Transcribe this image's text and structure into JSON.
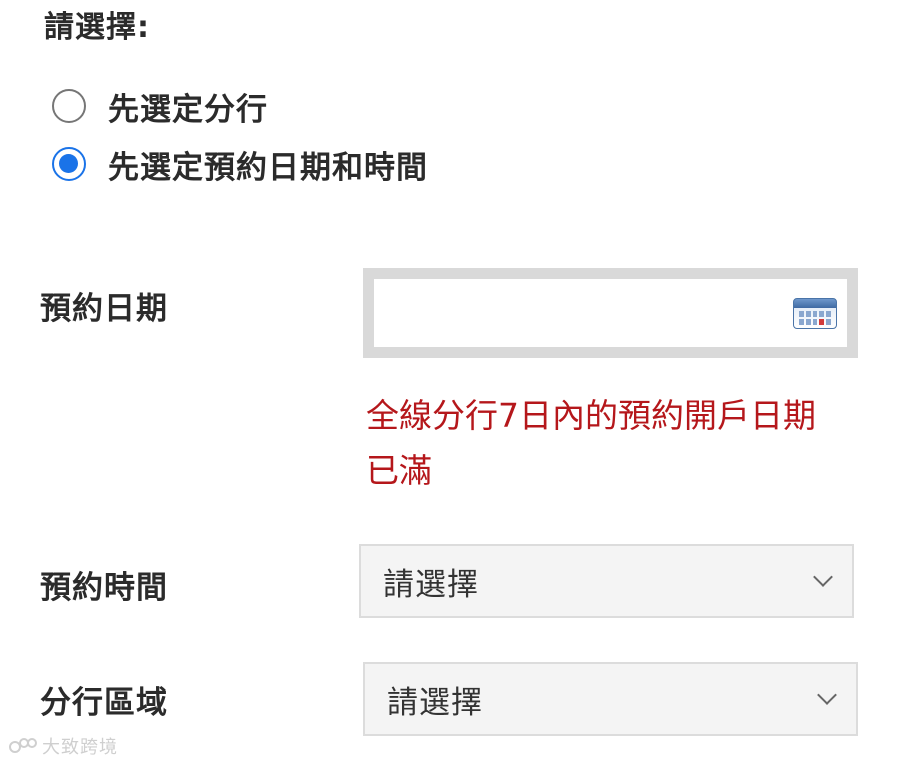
{
  "heading": "請選擇:",
  "mode_options": [
    {
      "label": "先選定分行",
      "checked": false
    },
    {
      "label": "先選定預約日期和時間",
      "checked": true
    }
  ],
  "date_field": {
    "label": "預約日期",
    "value": "",
    "icon": "calendar-icon"
  },
  "error_message": "全線分行7日內的預約開戶日期已滿",
  "time_field": {
    "label": "預約時間",
    "selected": "請選擇"
  },
  "area_field": {
    "label": "分行區域",
    "selected": "請選擇"
  },
  "watermark": "大致跨境",
  "colors": {
    "accent": "#1a73e8",
    "error": "#b5171b"
  }
}
